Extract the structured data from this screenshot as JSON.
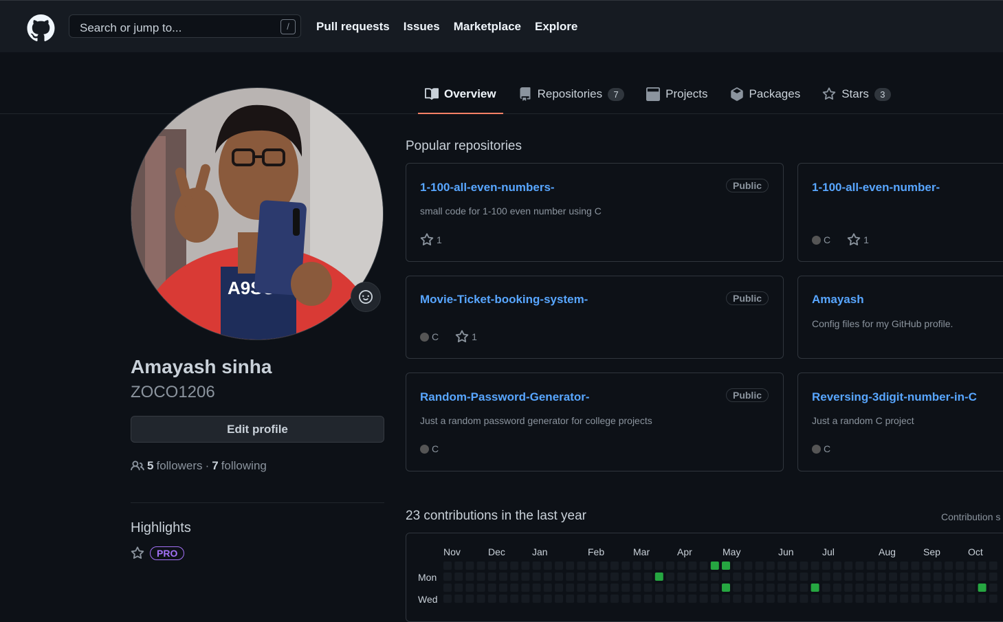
{
  "header": {
    "search_placeholder": "Search or jump to...",
    "search_shortcut": "/",
    "nav": [
      "Pull requests",
      "Issues",
      "Marketplace",
      "Explore"
    ]
  },
  "tabs": [
    {
      "label": "Overview",
      "icon": "book-icon",
      "active": true
    },
    {
      "label": "Repositories",
      "icon": "repo-icon",
      "count": "7"
    },
    {
      "label": "Projects",
      "icon": "project-icon"
    },
    {
      "label": "Packages",
      "icon": "package-icon"
    },
    {
      "label": "Stars",
      "icon": "star-icon",
      "count": "3"
    }
  ],
  "profile": {
    "full_name": "Amayash sinha",
    "username": "ZOCO1206",
    "edit_label": "Edit profile",
    "followers_count": "5",
    "followers_label": "followers",
    "sep": "·",
    "following_count": "7",
    "following_label": "following",
    "highlights_title": "Highlights",
    "pro_label": "PRO"
  },
  "popular": {
    "title": "Popular repositories",
    "repos": [
      {
        "name": "1-100-all-even-numbers-",
        "badge": "Public",
        "desc": "small code for 1-100 even number using C",
        "lang": "",
        "stars": "1"
      },
      {
        "name": "1-100-all-even-number-",
        "badge": "",
        "desc": "",
        "lang": "C",
        "stars": "1"
      },
      {
        "name": "Movie-Ticket-booking-system-",
        "badge": "Public",
        "desc": "",
        "lang": "C",
        "stars": "1"
      },
      {
        "name": "Amayash",
        "badge": "",
        "desc": "Config files for my GitHub profile.",
        "lang": "",
        "stars": ""
      },
      {
        "name": "Random-Password-Generator-",
        "badge": "Public",
        "desc": "Just a random password generator for college projects",
        "lang": "C",
        "stars": ""
      },
      {
        "name": "Reversing-3digit-number-in-C",
        "badge": "",
        "desc": "Just a random C project",
        "lang": "C",
        "stars": ""
      }
    ]
  },
  "contributions": {
    "title": "23 contributions in the last year",
    "settings": "Contribution s",
    "months": [
      "Nov",
      "Dec",
      "Jan",
      "Feb",
      "Mar",
      "Apr",
      "May",
      "Jun",
      "Jul",
      "Aug",
      "Sep",
      "Oct"
    ],
    "weekdays": [
      "Mon",
      "Wed"
    ]
  },
  "colors": {
    "accent_link": "#58a6ff",
    "tab_underline": "#f78166",
    "pro": "#a371f7",
    "contrib_empty": "#161b22",
    "contrib_level1": "#0e4429",
    "contrib_level2": "#26a641"
  }
}
